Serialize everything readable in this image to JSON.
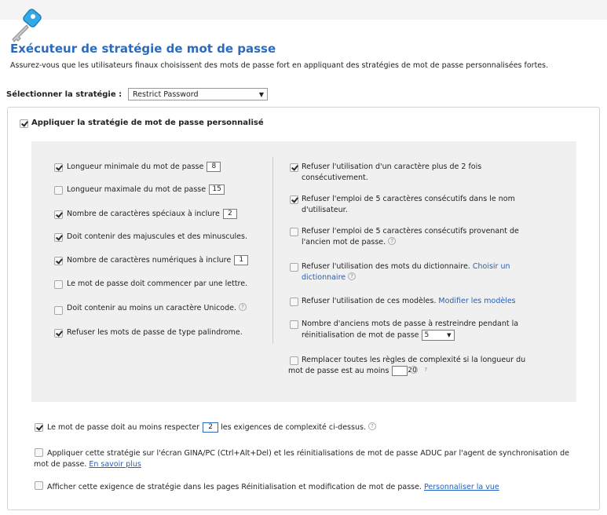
{
  "header": {
    "title": "Exécuteur de stratégie de mot de passe",
    "description": "Assurez-vous que les utilisateurs finaux choisissent des mots de passe fort en appliquant des stratégies de mot de passe personnalisées fortes."
  },
  "policy_select": {
    "label": "Sélectionner la stratégie :",
    "value": "Restrict Password"
  },
  "apply_custom": {
    "label": "Appliquer la stratégie de mot de passe personnalisé",
    "checked": true
  },
  "left_rules": [
    {
      "label": "Longueur minimale du mot de passe",
      "checked": true,
      "value": "8"
    },
    {
      "label": "Longueur maximale du mot de passe",
      "checked": false,
      "value": "15"
    },
    {
      "label": "Nombre de caractères spéciaux à inclure",
      "checked": true,
      "value": "2"
    },
    {
      "label": "Doit contenir des majuscules et des minuscules.",
      "checked": true
    },
    {
      "label": "Nombre de caractères numériques à inclure",
      "checked": true,
      "value": "1"
    },
    {
      "label": "Le mot de passe doit commencer par une lettre.",
      "checked": false
    },
    {
      "label": "Doit contenir au moins un caractère Unicode.",
      "checked": false,
      "help": "?"
    },
    {
      "label": "Refuser les mots de passe de type palindrome.",
      "checked": true
    }
  ],
  "right_rules": [
    {
      "label": "Refuser l'utilisation d'un caractère plus de 2 fois consécutivement.",
      "checked": true
    },
    {
      "label": "Refuser l'emploi de 5 caractères consécutifs dans le nom d'utilisateur.",
      "checked": true
    },
    {
      "label": "Refuser l'emploi de 5 caractères consécutifs provenant de l'ancien mot de passe.",
      "checked": false,
      "help": "?"
    },
    {
      "label": "Refuser l'utilisation des mots du dictionnaire.",
      "link": "Choisir un dictionnaire",
      "checked": false,
      "help": "?"
    },
    {
      "label": "Refuser l'utilisation de ces modèles.",
      "link": "Modifier les modèles",
      "checked": false
    },
    {
      "label": "Nombre d'anciens mots de passe à restreindre pendant la réinitialisation de mot de passe",
      "checked": false,
      "select_value": "5"
    },
    {
      "label": "Remplacer toutes les règles de complexité si la longueur du mot de passe est au moins",
      "checked": false,
      "value": "20",
      "help": "?"
    }
  ],
  "bottom": {
    "complexity": {
      "label_before": "Le mot de passe doit au moins respecter",
      "value": "2",
      "label_after": "les exigences de complexité ci-dessus.",
      "checked": true,
      "help": "?"
    },
    "gina": {
      "label": "Appliquer cette stratégie sur l'écran GINA/PC (Ctrl+Alt+Del) et les réinitialisations de mot de passe ADUC par l'agent de synchronisation de mot de passe.",
      "link": "En savoir plus",
      "checked": false
    },
    "show_req": {
      "label": "Afficher cette exigence de stratégie dans les pages Réinitialisation et modification de mot de passe.",
      "link": "Personnaliser la vue",
      "checked": false
    }
  },
  "colors": {
    "title": "#2a6bbf",
    "link": "#1f5fbf",
    "panel": "#f0f0f0"
  }
}
